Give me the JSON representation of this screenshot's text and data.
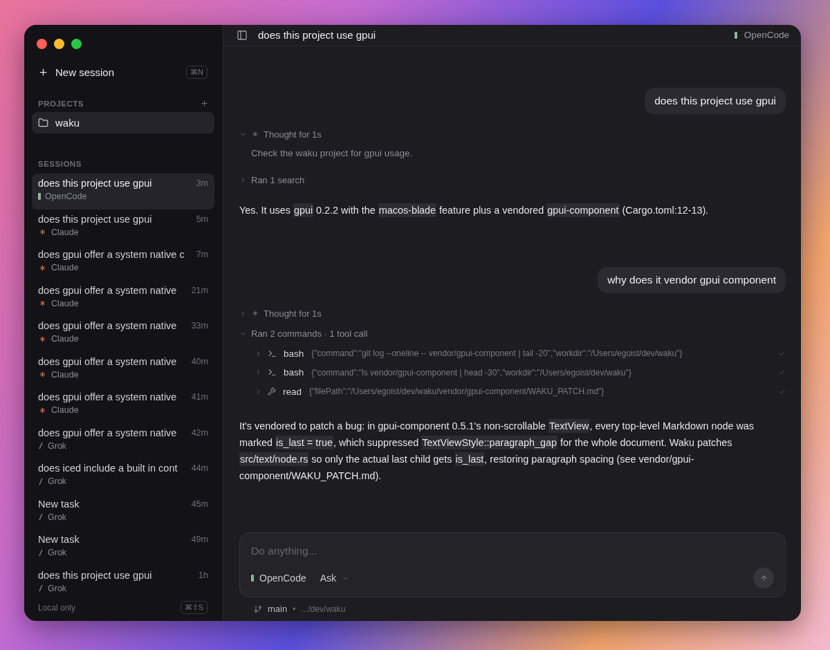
{
  "sidebar": {
    "new_session": {
      "label": "New session",
      "shortcut": "⌘N"
    },
    "projects": {
      "heading": "PROJECTS",
      "items": [
        {
          "name": "waku",
          "selected": true
        }
      ]
    },
    "sessions": {
      "heading": "SESSIONS",
      "items": [
        {
          "title": "does this project use gpui",
          "time": "3m",
          "agent": "OpenCode",
          "kind": "opencode",
          "selected": true
        },
        {
          "title": "does this project use gpui",
          "time": "5m",
          "agent": "Claude",
          "kind": "claude",
          "selected": false
        },
        {
          "title": "does gpui offer a system native c",
          "time": "7m",
          "agent": "Claude",
          "kind": "claude",
          "selected": false
        },
        {
          "title": "does gpui offer a system native",
          "time": "21m",
          "agent": "Claude",
          "kind": "claude",
          "selected": false
        },
        {
          "title": "does gpui offer a system native",
          "time": "33m",
          "agent": "Claude",
          "kind": "claude",
          "selected": false
        },
        {
          "title": "does gpui offer a system native",
          "time": "40m",
          "agent": "Claude",
          "kind": "claude",
          "selected": false
        },
        {
          "title": "does gpui offer a system native",
          "time": "41m",
          "agent": "Claude",
          "kind": "claude",
          "selected": false
        },
        {
          "title": "does gpui offer a system native",
          "time": "42m",
          "agent": "Grok",
          "kind": "grok",
          "selected": false
        },
        {
          "title": "does iced include a built in cont",
          "time": "44m",
          "agent": "Grok",
          "kind": "grok",
          "selected": false
        },
        {
          "title": "New task",
          "time": "45m",
          "agent": "Grok",
          "kind": "grok",
          "selected": false
        },
        {
          "title": "New task",
          "time": "49m",
          "agent": "Grok",
          "kind": "grok",
          "selected": false
        },
        {
          "title": "does this project use gpui",
          "time": "1h",
          "agent": "Grok",
          "kind": "grok",
          "selected": false
        }
      ]
    },
    "footer": {
      "label": "Local only",
      "shortcut": "⌘⇧S"
    }
  },
  "header": {
    "title": "does this project use gpui",
    "agent": "OpenCode"
  },
  "conversation": [
    {
      "kind": "user",
      "text": "does this project use gpui"
    },
    {
      "kind": "thought",
      "label": "Thought for 1s",
      "expanded": true,
      "detail": "Check the waku project for gpui usage."
    },
    {
      "kind": "group",
      "label": "Ran 1 search",
      "expanded": false
    },
    {
      "kind": "answer",
      "segments": [
        {
          "text": "Yes. It uses ",
          "code": false
        },
        {
          "text": "gpui",
          "code": true
        },
        {
          "text": " 0.2.2 with the ",
          "code": false
        },
        {
          "text": "macos-blade",
          "code": true
        },
        {
          "text": " feature plus a vendored ",
          "code": false
        },
        {
          "text": "gpui-component",
          "code": true
        },
        {
          "text": " (Cargo.toml:12-13).",
          "code": false
        }
      ]
    },
    {
      "kind": "user",
      "text": "why does it vendor gpui component"
    },
    {
      "kind": "thought",
      "label": "Thought for 1s",
      "expanded": false
    },
    {
      "kind": "group",
      "label": "Ran 2 commands · 1 tool call",
      "expanded": true,
      "calls": [
        {
          "tool": "bash",
          "kind": "terminal",
          "args": "{\"command\":\"git log --oneline -- vendor/gpui-component | tail -20\",\"workdir\":\"/Users/egoist/dev/waku\"}"
        },
        {
          "tool": "bash",
          "kind": "terminal",
          "args": "{\"command\":\"ls vendor/gpui-component | head -30\",\"workdir\":\"/Users/egoist/dev/waku\"}"
        },
        {
          "tool": "read",
          "kind": "wrench",
          "args": "{\"filePath\":\"/Users/egoist/dev/waku/vendor/gpui-component/WAKU_PATCH.md\"}"
        }
      ]
    },
    {
      "kind": "answer",
      "segments": [
        {
          "text": "It's vendored to patch a bug: in gpui-component 0.5.1's non-scrollable ",
          "code": false
        },
        {
          "text": "TextView",
          "code": true
        },
        {
          "text": ", every top-level Markdown node was marked ",
          "code": false
        },
        {
          "text": "is_last = true",
          "code": true
        },
        {
          "text": ", which suppressed ",
          "code": false
        },
        {
          "text": "TextViewStyle::paragraph_gap",
          "code": true
        },
        {
          "text": " for the whole document. Waku patches ",
          "code": false
        },
        {
          "text": "src/text/node.rs",
          "code": true
        },
        {
          "text": " so only the actual last child gets ",
          "code": false
        },
        {
          "text": "is_last",
          "code": true
        },
        {
          "text": ", restoring paragraph spacing (see vendor/gpui-component/WAKU_PATCH.md).",
          "code": false
        }
      ]
    }
  ],
  "composer": {
    "placeholder": "Do anything...",
    "agent": "OpenCode",
    "mode": "Ask"
  },
  "status": {
    "branch": "main",
    "separator": "•",
    "path": ".../dev/waku"
  }
}
